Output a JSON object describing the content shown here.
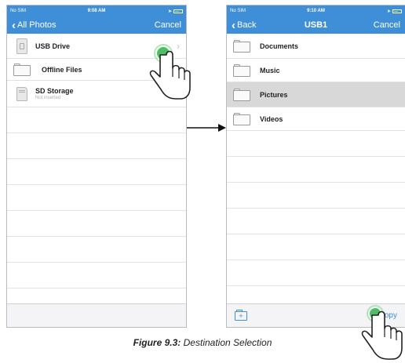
{
  "left_screen": {
    "status": {
      "carrier": "No SIM",
      "time": "9:08 AM"
    },
    "nav": {
      "back_label": "All Photos",
      "cancel_label": "Cancel"
    },
    "items": [
      {
        "label": "USB Drive",
        "icon": "usb-drive-icon"
      },
      {
        "label": "Offline Files",
        "icon": "folder-icon"
      },
      {
        "label": "SD Storage",
        "sublabel": "Not inserted",
        "icon": "sd-card-icon"
      }
    ]
  },
  "right_screen": {
    "status": {
      "carrier": "No SIM",
      "time": "9:10 AM"
    },
    "nav": {
      "back_label": "Back",
      "title": "USB1",
      "cancel_label": "Cancel"
    },
    "folders": [
      {
        "label": "Documents"
      },
      {
        "label": "Music"
      },
      {
        "label": "Pictures",
        "selected": true
      },
      {
        "label": "Videos"
      }
    ],
    "toolbar": {
      "copy_label": "Copy",
      "new_folder_icon": "new-folder-icon"
    }
  },
  "caption": {
    "figure_label": "Figure 9.3:",
    "text": "Destination Selection"
  },
  "colors": {
    "accent": "#3f8fd8",
    "selected_row": "#d8d8d8",
    "touch_dot": "#2fb34a"
  }
}
